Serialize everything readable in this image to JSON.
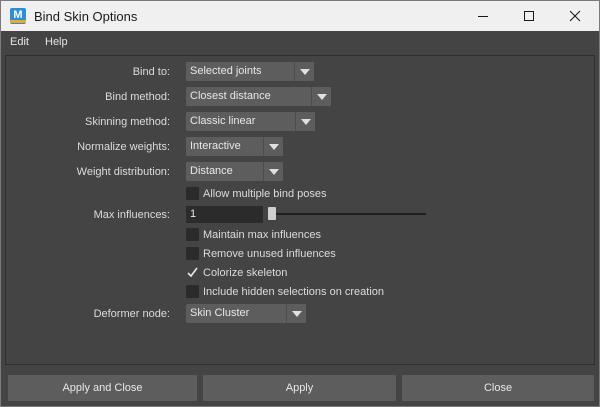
{
  "window": {
    "title": "Bind Skin Options",
    "app_icon_letter": "M",
    "controls": [
      "minimize-icon",
      "maximize-icon",
      "close-icon"
    ]
  },
  "menu": {
    "items": [
      {
        "label": "Edit"
      },
      {
        "label": "Help"
      }
    ]
  },
  "options": {
    "bind_to": {
      "label": "Bind to:",
      "value": "Selected joints"
    },
    "bind_method": {
      "label": "Bind method:",
      "value": "Closest distance"
    },
    "skinning_method": {
      "label": "Skinning method:",
      "value": "Classic linear"
    },
    "normalize_weights": {
      "label": "Normalize weights:",
      "value": "Interactive"
    },
    "weight_distribution": {
      "label": "Weight distribution:",
      "value": "Distance"
    },
    "allow_multiple_bind_poses": {
      "label": "Allow multiple bind poses",
      "checked": false
    },
    "max_influences": {
      "label": "Max influences:",
      "value": "1",
      "slider_fraction": 0.0
    },
    "maintain_max_influences": {
      "label": "Maintain max influences",
      "checked": false
    },
    "remove_unused_influences": {
      "label": "Remove unused influences",
      "checked": false
    },
    "colorize_skeleton": {
      "label": "Colorize skeleton",
      "checked": true
    },
    "include_hidden_selections": {
      "label": "Include hidden selections on creation",
      "checked": false
    },
    "deformer_node": {
      "label": "Deformer node:",
      "value": "Skin Cluster"
    }
  },
  "buttons": {
    "apply_and_close": "Apply and Close",
    "apply": "Apply",
    "close": "Close"
  },
  "colors": {
    "background": "#444444",
    "control": "#5d5d5d",
    "field": "#2b2b2b",
    "titlebar": "#f0f0f0"
  }
}
